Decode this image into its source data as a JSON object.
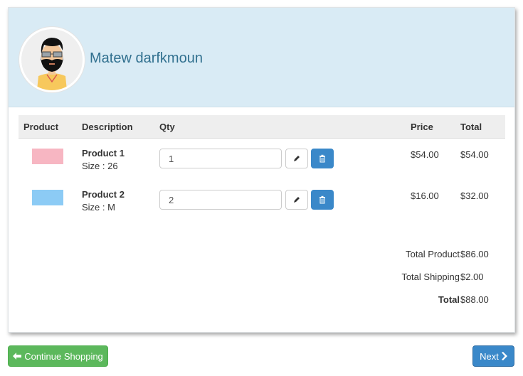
{
  "user": {
    "name": "Matew darfkmoun",
    "avatar_icon": "bearded-man-avatar"
  },
  "table": {
    "headers": {
      "product": "Product",
      "description": "Description",
      "qty": "Qty",
      "price": "Price",
      "total": "Total"
    },
    "rows": [
      {
        "thumb_color": "#f7b6c2",
        "name": "Product 1",
        "size": "Size : 26",
        "qty": "1",
        "price": "$54.00",
        "total": "$54.00"
      },
      {
        "thumb_color": "#8ccbf5",
        "name": "Product 2",
        "size": "Size : M",
        "qty": "2",
        "price": "$16.00",
        "total": "$32.00"
      }
    ]
  },
  "summary": {
    "total_product_label": "Total Product",
    "total_product": "$86.00",
    "total_shipping_label": "Total Shipping",
    "total_shipping": "$2.00",
    "total_label": "Total",
    "total": "$88.00"
  },
  "buttons": {
    "continue": "Continue Shopping",
    "next": "Next"
  },
  "colors": {
    "header_bg": "#d9ebf5",
    "name": "#31708f",
    "primary": "#3a88c9",
    "success": "#5cb85c"
  }
}
